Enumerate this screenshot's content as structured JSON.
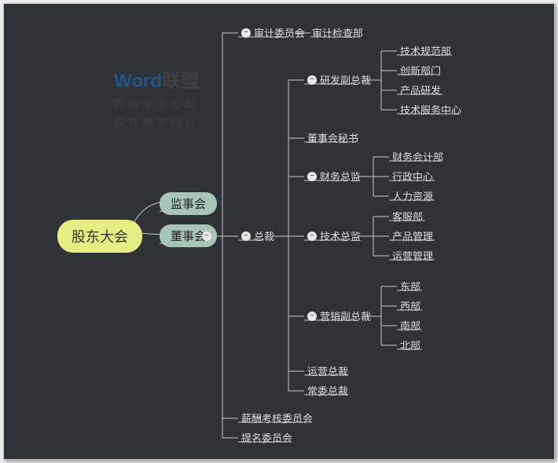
{
  "watermark": {
    "word1": "Word",
    "word2": "联盟",
    "sub1": "国内专业办公",
    "sub2": "软件教学网台"
  },
  "root": "股东大会",
  "L1": {
    "a": "监事会",
    "b": "董事会"
  },
  "L2": {
    "a": "审计委员会",
    "b": "总裁",
    "c": "薪酬考核委员会",
    "d": "提名委员会"
  },
  "L2a_child": "审计检查部",
  "president": {
    "a": "研发副总裁",
    "b": "董事会秘书",
    "c": "财务总监",
    "d": "技术总监",
    "e": "营销副总裁",
    "f": "运营总裁",
    "g": "常委总裁"
  },
  "rnd": {
    "a": "技术规范部",
    "b": "创新部门",
    "c": "产品研发",
    "d": "技术服务中心"
  },
  "finance": {
    "a": "财务会计部",
    "b": "行政中心",
    "c": "人力资源"
  },
  "tech": {
    "a": "客服部",
    "b": "产品管理",
    "c": "运营管理"
  },
  "sales": {
    "a": "东部",
    "b": "西部",
    "c": "南部",
    "d": "北部"
  },
  "marker": "−"
}
